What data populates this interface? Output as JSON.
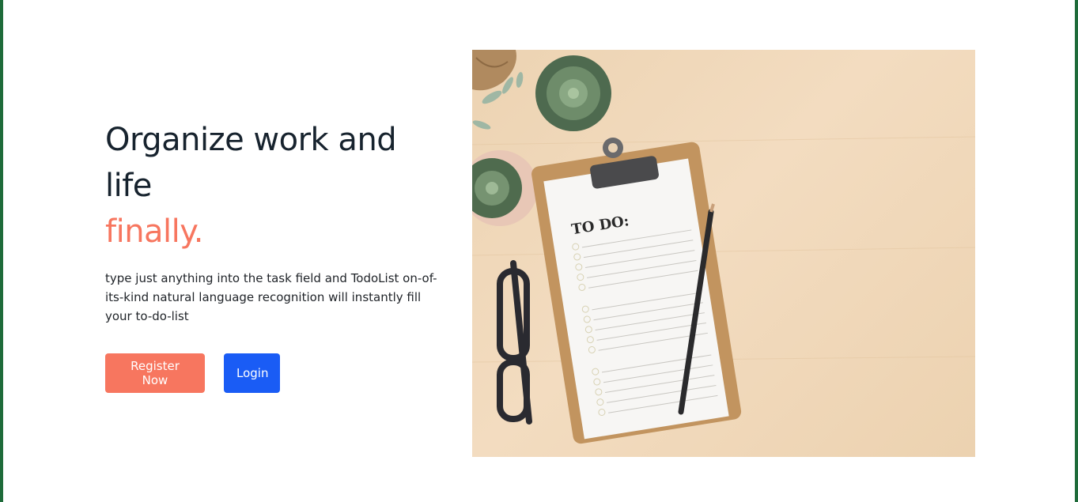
{
  "hero": {
    "headline_line1": "Organize work and",
    "headline_line2": "life",
    "headline_accent": "finally.",
    "description": "type just anything into the task field and TodoList on-of-its-kind natural language recognition will instantly fill your to-do-list",
    "register_label": "Register Now",
    "login_label": "Login"
  },
  "illustration": {
    "clipboard_heading": "TO DO:"
  },
  "colors": {
    "accent": "#f7765f",
    "primary": "#1a5cf5",
    "heading": "#17232e",
    "frame_border": "#1e6b3a"
  }
}
